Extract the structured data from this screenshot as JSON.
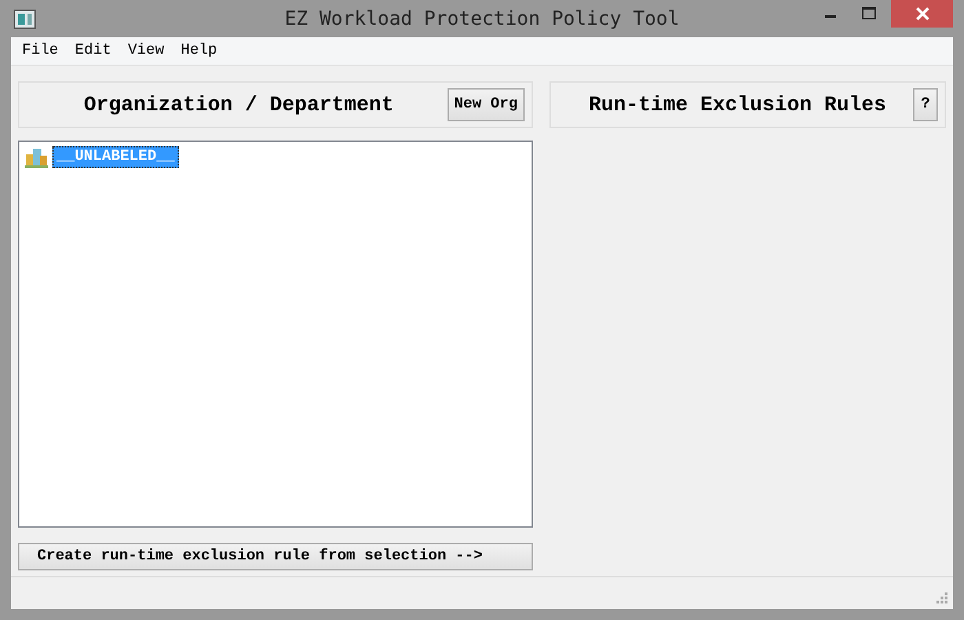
{
  "window": {
    "title": "EZ Workload Protection Policy Tool"
  },
  "menu": [
    "File",
    "Edit",
    "View",
    "Help"
  ],
  "left_panel": {
    "heading": "Organization / Department",
    "button": "New Org",
    "tree": [
      {
        "label": "__UNLABELED__",
        "selected": true
      }
    ],
    "action_button": "Create run-time exclusion rule from selection -->"
  },
  "right_panel": {
    "heading": "Run-time Exclusion Rules",
    "button": "?"
  }
}
